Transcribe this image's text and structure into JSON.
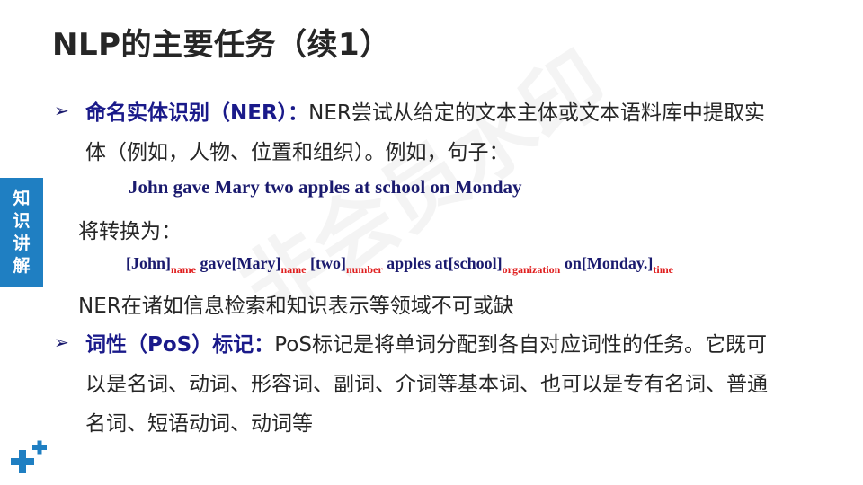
{
  "title": "NLP的主要任务（续1）",
  "side_tab": [
    "知",
    "识",
    "讲",
    "解"
  ],
  "watermark": "非会员水印",
  "colors": {
    "accent": "#1f7fc2",
    "keyword": "#1a1a8a",
    "tag": "#e02020",
    "text": "#262626"
  },
  "ner": {
    "bullet": "➢",
    "label": "命名实体识别（NER）：",
    "text_line1": "NER尝试从给定的文本主体或文本语料库中提取实",
    "text_line2": "体（例如，人物、位置和组织）。例如，句子：",
    "example_sentence": "John gave Mary two apples at school on Monday",
    "convert_label": "将转换为：",
    "annotated": [
      {
        "text": "[John]",
        "tag": "name"
      },
      {
        "text": " gave[Mary]",
        "tag": "name"
      },
      {
        "text": " [two]",
        "tag": "number"
      },
      {
        "text": " apples at[school]",
        "tag": "organization"
      },
      {
        "text": " on[Monday.]",
        "tag": "time"
      }
    ],
    "conclusion": "NER在诸如信息检索和知识表示等领域不可或缺"
  },
  "pos": {
    "bullet": "➢",
    "label": "词性（PoS）标记：",
    "text_line1": "PoS标记是将单词分配到各自对应词性的任务。它既可",
    "text_line2": "以是名词、动词、形容词、副词、介词等基本词、也可以是专有名词、普通",
    "text_line3": "名词、短语动词、动词等"
  }
}
